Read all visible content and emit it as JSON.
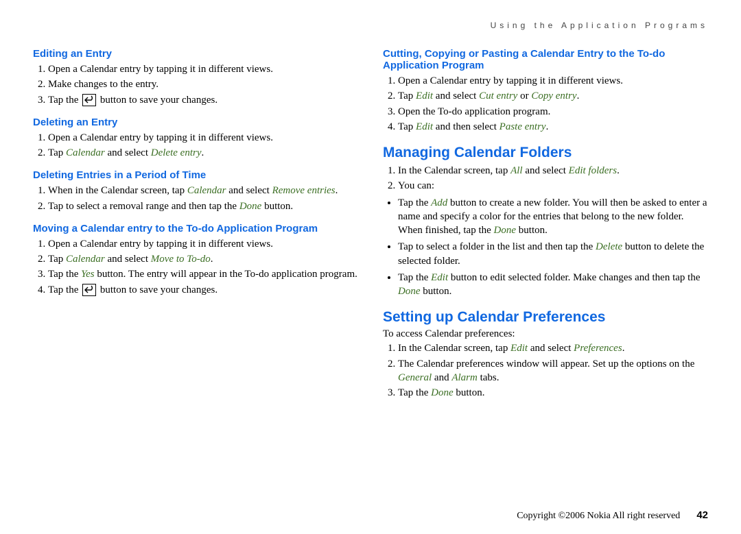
{
  "running_head": "Using the Application Programs",
  "left": {
    "h_edit": "Editing an Entry",
    "edit_steps": [
      {
        "pre": "Open a Calendar entry by tapping it in different views."
      },
      {
        "pre": "Make changes to the entry."
      },
      {
        "pre": "Tap the ",
        "icon": true,
        "post": " button to save your changes."
      }
    ],
    "h_delete": "Deleting an Entry",
    "delete_steps_1": "Open a Calendar entry by tapping it in different views.",
    "delete_steps_2a": "Tap ",
    "delete_steps_2b": "Calendar",
    "delete_steps_2c": " and select ",
    "delete_steps_2d": "Delete entry",
    "delete_steps_2e": ".",
    "h_period": "Deleting Entries in a Period of Time",
    "period_1a": "When in the Calendar screen, tap ",
    "period_1b": "Calendar",
    "period_1c": " and select ",
    "period_1d": "Remove entries",
    "period_1e": ".",
    "period_2a": "Tap to select a removal range and then tap the ",
    "period_2b": "Done",
    "period_2c": " button.",
    "h_move": "Moving a Calendar entry to the To-do Application Program",
    "move_1": "Open a Calendar entry by tapping it in different views.",
    "move_2a": "Tap ",
    "move_2b": "Calendar",
    "move_2c": " and select ",
    "move_2d": "Move to To-do",
    "move_2e": ".",
    "move_3a": "Tap the ",
    "move_3b": "Yes",
    "move_3c": " button. The entry will appear in the To-do application program.",
    "move_4a": "Tap the ",
    "move_4c": " button to save your changes."
  },
  "right": {
    "h_cut": "Cutting, Copying or Pasting a Calendar Entry to the To-do Application Program",
    "cut_1": "Open a Calendar entry by tapping it in different views.",
    "cut_2a": "Tap ",
    "cut_2b": "Edit",
    "cut_2c": " and select ",
    "cut_2d": "Cut entry",
    "cut_2e": " or ",
    "cut_2f": "Copy entry",
    "cut_2g": ".",
    "cut_3": "Open the To-do application program.",
    "cut_4a": "Tap ",
    "cut_4b": "Edit",
    "cut_4c": " and then select ",
    "cut_4d": "Paste entry",
    "cut_4e": ".",
    "h_folders": "Managing Calendar Folders",
    "fold_1a": "In the Calendar screen, tap ",
    "fold_1b": "All",
    "fold_1c": " and select ",
    "fold_1d": "Edit folders",
    "fold_1e": ".",
    "fold_2": "You can:",
    "bul_1a": "Tap the ",
    "bul_1b": "Add",
    "bul_1c": " button to create a new folder. You will then be asked to enter a name and specify a color for the entries that belong to the new folder. When finished, tap the ",
    "bul_1d": "Done",
    "bul_1e": " button.",
    "bul_2a": "Tap to select a folder in the list and then tap the ",
    "bul_2b": "Delete",
    "bul_2c": " button to delete the selected folder.",
    "bul_3a": "Tap the ",
    "bul_3b": "Edit",
    "bul_3c": " button to edit selected folder. Make changes and then tap the ",
    "bul_3d": "Done",
    "bul_3e": " button.",
    "h_prefs": "Setting up Calendar Preferences",
    "prefs_intro": "To access Calendar preferences:",
    "pref_1a": "In the Calendar screen, tap ",
    "pref_1b": "Edit",
    "pref_1c": " and select ",
    "pref_1d": "Preferences",
    "pref_1e": ".",
    "pref_2a": "The Calendar preferences window will appear. Set up the options on the ",
    "pref_2b": "General",
    "pref_2c": " and ",
    "pref_2d": "Alarm",
    "pref_2e": " tabs.",
    "pref_3a": "Tap the ",
    "pref_3b": "Done",
    "pref_3c": " button."
  },
  "footer": {
    "copyright": "Copyright ©2006 Nokia All right reserved",
    "page": "42"
  }
}
